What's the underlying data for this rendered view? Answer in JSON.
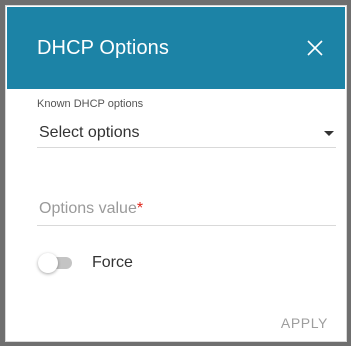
{
  "dialog": {
    "title": "DHCP Options",
    "close_icon": "close-icon",
    "header_color": "#1c83a6"
  },
  "known_options": {
    "label": "Known DHCP options",
    "selected": "Select options",
    "caret_icon": "caret-down-icon"
  },
  "options_value": {
    "placeholder": "Options value",
    "required_mark": "*",
    "value": "",
    "required_color": "#e0261b"
  },
  "force": {
    "label": "Force",
    "enabled": false
  },
  "footer": {
    "apply_label": "APPLY"
  }
}
